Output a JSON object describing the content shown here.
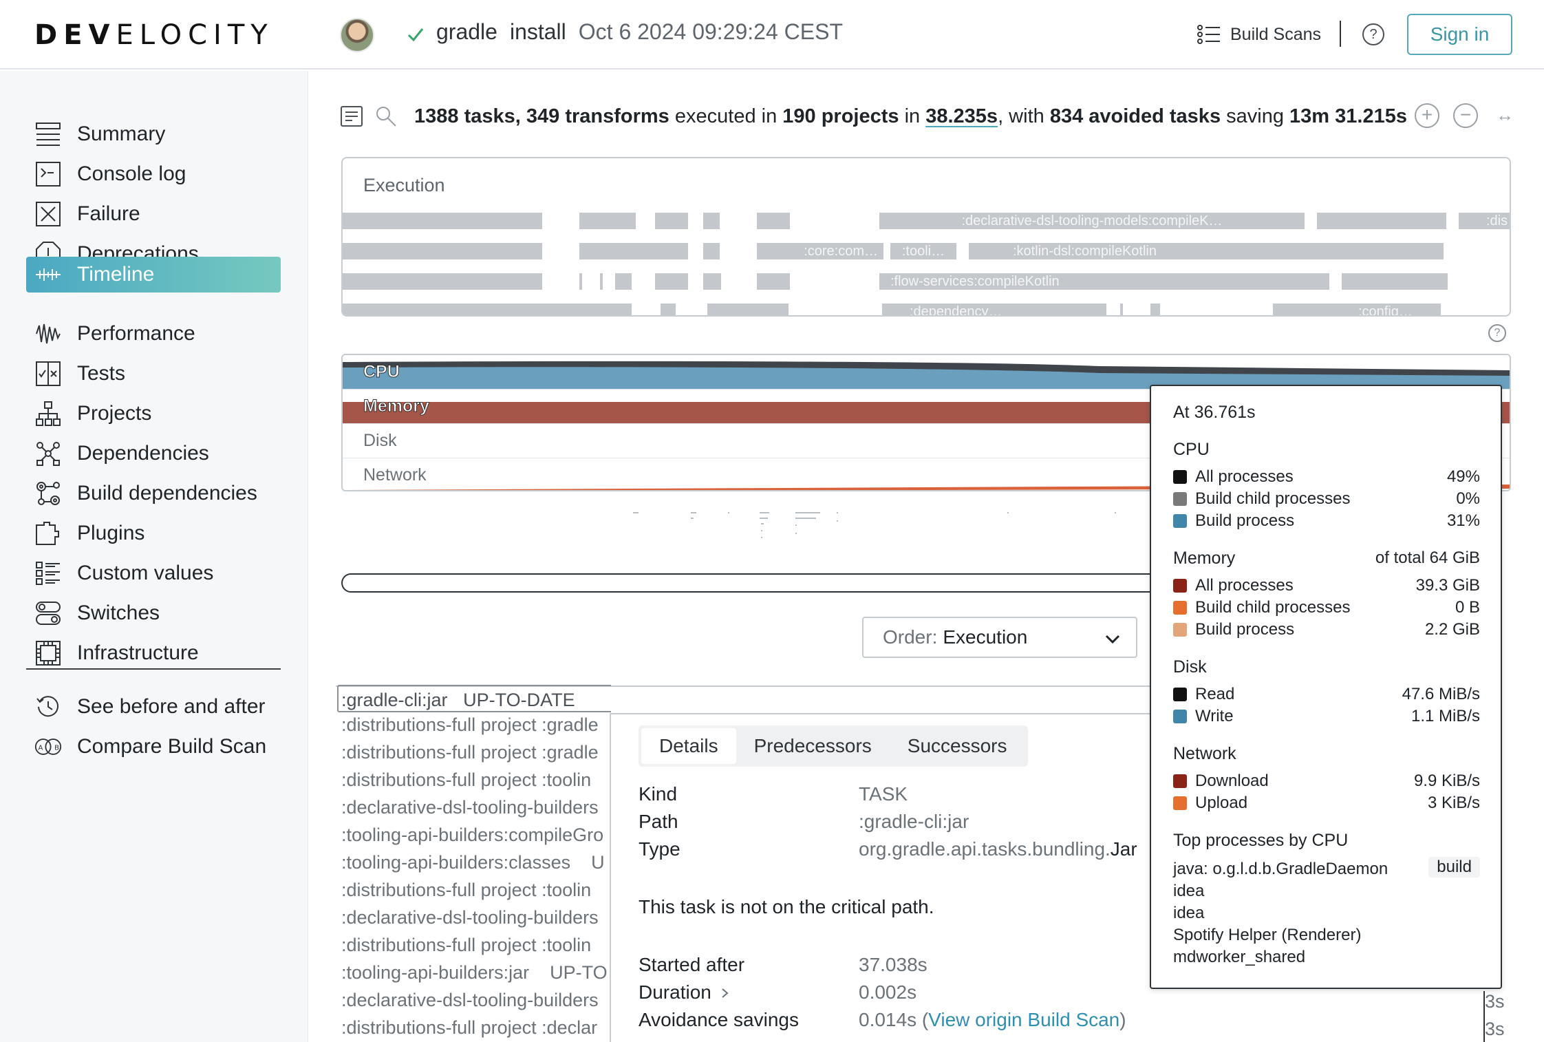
{
  "header": {
    "logo_prefix": "DEV",
    "logo_rest": "ELOCITY",
    "build_tool": "gradle",
    "build_task": "install",
    "build_time": "Oct 6 2024 09:29:24 CEST",
    "build_scans_label": "Build Scans",
    "help_label": "?",
    "sign_in_label": "Sign in"
  },
  "sidebar": {
    "items": [
      {
        "label": "Summary",
        "icon": "summary-icon"
      },
      {
        "label": "Console log",
        "icon": "console-icon"
      },
      {
        "label": "Failure",
        "icon": "failure-icon"
      },
      {
        "label": "Deprecations",
        "icon": "deprecation-icon"
      },
      {
        "label": "Timeline",
        "icon": "timeline-icon"
      },
      {
        "label": "Performance",
        "icon": "performance-icon"
      },
      {
        "label": "Tests",
        "icon": "tests-icon"
      },
      {
        "label": "Projects",
        "icon": "projects-icon"
      },
      {
        "label": "Dependencies",
        "icon": "dependencies-icon"
      },
      {
        "label": "Build dependencies",
        "icon": "build-dependencies-icon"
      },
      {
        "label": "Plugins",
        "icon": "plugins-icon"
      },
      {
        "label": "Custom values",
        "icon": "custom-values-icon"
      },
      {
        "label": "Switches",
        "icon": "switches-icon"
      },
      {
        "label": "Infrastructure",
        "icon": "infrastructure-icon"
      }
    ],
    "extra": [
      {
        "label": "See before and after",
        "icon": "history-icon"
      },
      {
        "label": "Compare Build Scan",
        "icon": "compare-icon"
      }
    ],
    "active": "Timeline"
  },
  "summary": {
    "tasks": "1388 tasks,",
    "transforms": "349 transforms",
    "executed_in": "executed in",
    "projects": "190 projects",
    "in": "in",
    "duration": "38.235s",
    "with": ", with",
    "avoided": "834 avoided tasks",
    "saving": "saving",
    "saved": "13m 31.215s"
  },
  "zoom": {
    "in": "+",
    "out": "−",
    "fit": "↔"
  },
  "execution": {
    "title": "Execution",
    "bar_labels": [
      ":declarative-dsl-tooling-models:compileK…",
      ":dis",
      ":core:com…",
      ":tooli…",
      ":kotlin-dsl:compileKotlin",
      ":flow-services:compileKotlin",
      ":dependency…",
      ":config…"
    ]
  },
  "resources": {
    "cpu": "CPU",
    "memory": "Memory",
    "disk": "Disk",
    "network": "Network",
    "help": "?"
  },
  "order": {
    "label": "Order:",
    "value": "Execution"
  },
  "task_list": {
    "selected": ":gradle-cli:jar",
    "selected_status": "UP-TO-DATE",
    "rows": [
      ":distributions-full project :gradle",
      ":distributions-full project :gradle",
      ":distributions-full project :toolin",
      ":declarative-dsl-tooling-builders",
      ":tooling-api-builders:compileGro",
      ":tooling-api-builders:classes    U",
      ":distributions-full project :toolin",
      ":declarative-dsl-tooling-builders",
      ":distributions-full project :toolin",
      ":tooling-api-builders:jar    UP-TO",
      ":declarative-dsl-tooling-builders",
      ":distributions-full project :declar"
    ]
  },
  "details": {
    "tabs": [
      "Details",
      "Predecessors",
      "Successors"
    ],
    "kind_label": "Kind",
    "kind_value": "TASK",
    "path_label": "Path",
    "path_value": ":gradle-cli:jar",
    "type_label": "Type",
    "type_prefix": "org.gradle.api.tasks.bundling.",
    "type_class": "Jar",
    "critical_note": "This task is not on the critical path.",
    "started_label": "Started after",
    "started_value": "37.038s",
    "duration_label": "Duration",
    "duration_value": "0.002s",
    "avoidance_label": "Avoidance savings",
    "avoidance_value": "0.014s (",
    "avoidance_link": "View origin Build Scan",
    "avoidance_close": ")",
    "right_durations": [
      "3s",
      "3s"
    ]
  },
  "tooltip": {
    "at": "At 36.761s",
    "cpu": {
      "title": "CPU",
      "rows": [
        {
          "name": "All processes",
          "value": "49%",
          "color": "#111111"
        },
        {
          "name": "Build child processes",
          "value": "0%",
          "color": "#7a7a7a"
        },
        {
          "name": "Build process",
          "value": "31%",
          "color": "#3f86a8"
        }
      ]
    },
    "memory": {
      "title": "Memory",
      "total": "of total 64 GiB",
      "rows": [
        {
          "name": "All processes",
          "value": "39.3 GiB",
          "color": "#8a2417"
        },
        {
          "name": "Build child processes",
          "value": "0 B",
          "color": "#e46f2f"
        },
        {
          "name": "Build process",
          "value": "2.2 GiB",
          "color": "#e3a57a"
        }
      ]
    },
    "disk": {
      "title": "Disk",
      "rows": [
        {
          "name": "Read",
          "value": "47.6 MiB/s",
          "color": "#111111"
        },
        {
          "name": "Write",
          "value": "1.1 MiB/s",
          "color": "#3f86a8"
        }
      ]
    },
    "network": {
      "title": "Network",
      "rows": [
        {
          "name": "Download",
          "value": "9.9 KiB/s",
          "color": "#8a2417"
        },
        {
          "name": "Upload",
          "value": "3 KiB/s",
          "color": "#e46f2f"
        }
      ]
    },
    "top": {
      "title": "Top processes by CPU",
      "rows": [
        "java: o.g.l.d.b.GradleDaemon",
        "idea",
        "idea",
        "Spotify Helper (Renderer)",
        "mdworker_shared"
      ],
      "badge": "build"
    }
  },
  "colors": {
    "accent": "#4aa8c2",
    "cpu": "#6a9fbd",
    "memory": "#a65549",
    "task_bar": "#c4c8cc"
  }
}
